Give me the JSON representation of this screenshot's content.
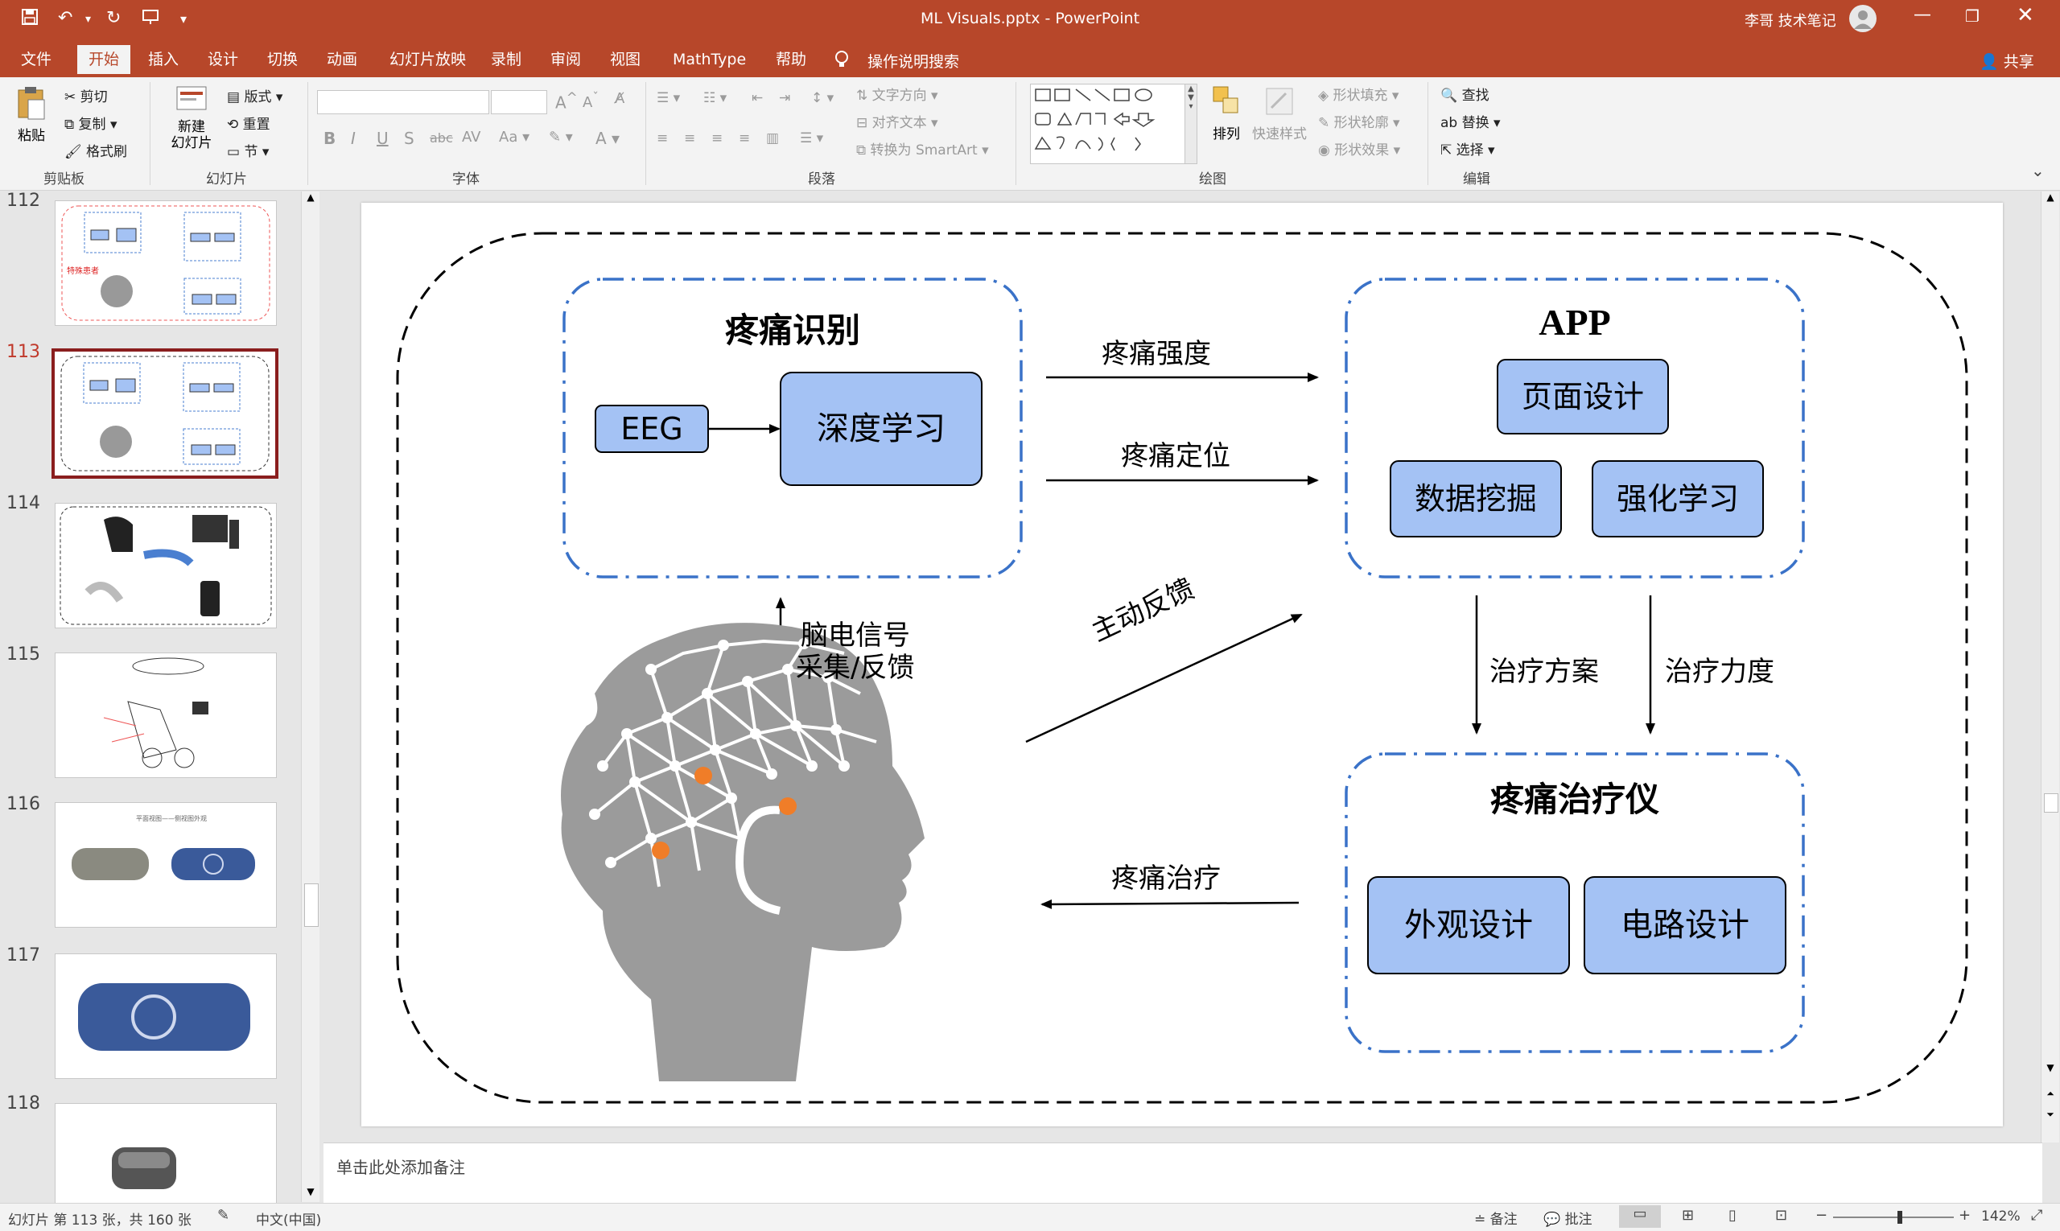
{
  "window": {
    "title": "ML Visuals.pptx  -  PowerPoint",
    "user": "李哥 技术笔记",
    "colors": {
      "brand": "#b7472a",
      "box_fill": "#a4c2f4",
      "dash_blue": "#3a72c8"
    }
  },
  "ribbon_tabs": [
    "文件",
    "开始",
    "插入",
    "设计",
    "切换",
    "动画",
    "幻灯片放映",
    "录制",
    "审阅",
    "视图",
    "MathType",
    "帮助"
  ],
  "tell_me": "操作说明搜索",
  "share": "共享",
  "ribbon": {
    "clipboard": {
      "paste": "粘贴",
      "cut": "剪切",
      "copy": "复制",
      "format_painter": "格式刷",
      "label": "剪贴板"
    },
    "slides": {
      "new_slide_1": "新建",
      "new_slide_2": "幻灯片",
      "layout": "版式",
      "reset": "重置",
      "section": "节",
      "label": "幻灯片"
    },
    "font": {
      "label": "字体"
    },
    "paragraph": {
      "text_direction": "文字方向",
      "align_text": "对齐文本",
      "smartart": "转换为 SmartArt",
      "label": "段落"
    },
    "drawing": {
      "arrange": "排列",
      "quick_styles": "快速样式",
      "shape_fill": "形状填充",
      "shape_outline": "形状轮廓",
      "shape_effects": "形状效果",
      "label": "绘图"
    },
    "editing": {
      "find": "查找",
      "replace": "替换",
      "select": "选择",
      "label": "编辑"
    }
  },
  "thumbnails": [
    {
      "num": "112",
      "selected": false
    },
    {
      "num": "113",
      "selected": true
    },
    {
      "num": "114",
      "selected": false
    },
    {
      "num": "115",
      "selected": false
    },
    {
      "num": "116",
      "selected": false
    },
    {
      "num": "117",
      "selected": false
    },
    {
      "num": "118",
      "selected": false
    }
  ],
  "slide": {
    "pain_recog": {
      "title": "疼痛识别",
      "eeg": "EEG",
      "dl": "深度学习"
    },
    "app": {
      "title": "APP",
      "page_design": "页面设计",
      "data_mining": "数据挖掘",
      "rl": "强化学习"
    },
    "device": {
      "title": "疼痛治疗仪",
      "appearance": "外观设计",
      "circuit": "电路设计"
    },
    "arrows": {
      "intensity": "疼痛强度",
      "location": "疼痛定位",
      "active_feedback": "主动反馈",
      "eeg_signal_1": "脑电信号",
      "eeg_signal_2": "采集/反馈",
      "plan": "治疗方案",
      "strength": "治疗力度",
      "treatment": "疼痛治疗"
    }
  },
  "notes_placeholder": "单击此处添加备注",
  "status": {
    "slide_info": "幻灯片 第 113 张，共 160 张",
    "language": "中文(中国)",
    "notes": "备注",
    "comments": "批注",
    "zoom": "142%",
    "zoom_level": 0.55
  }
}
